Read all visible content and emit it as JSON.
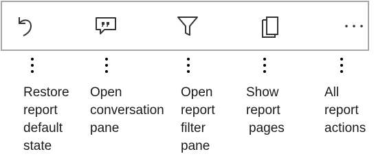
{
  "toolbar": {
    "buttons": [
      {
        "icon": "undo-icon",
        "label": "Restore report default state"
      },
      {
        "icon": "comment-icon",
        "label": "Open conversation pane"
      },
      {
        "icon": "filter-icon",
        "label": "Open report filter pane"
      },
      {
        "icon": "pages-icon",
        "label": "Show report pages"
      },
      {
        "icon": "more-icon",
        "label": "All report actions"
      }
    ]
  },
  "callouts": [
    {
      "lines": [
        "Restore",
        "report",
        "default",
        "state"
      ]
    },
    {
      "lines": [
        "Open",
        "conversation",
        "pane"
      ]
    },
    {
      "lines": [
        "Open",
        "report",
        "filter",
        "pane"
      ]
    },
    {
      "lines": [
        "Show",
        "report",
        "pages"
      ]
    },
    {
      "lines": [
        "All",
        "report",
        "actions"
      ]
    }
  ],
  "colors": {
    "border": "#a6a6a6",
    "icon": "#333333",
    "text": "#1a1a1a"
  }
}
